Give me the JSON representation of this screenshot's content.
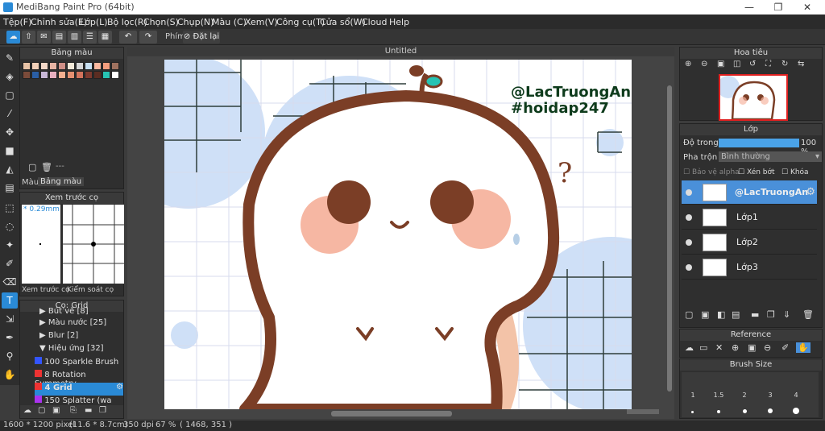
{
  "window": {
    "title": "MediBang Paint Pro (64bit)",
    "min": "—",
    "max": "❐",
    "close": "✕"
  },
  "menu": [
    "Tệp(F)",
    "Chỉnh sửa(E)",
    "Lớp(L)",
    "Bộ lọc(R)",
    "Chọn(S)",
    "Chụp(N)",
    "Màu (C)",
    "Xem(V)",
    "Công cụ(T)",
    "Cửa sổ(W)",
    "Cloud",
    "Help"
  ],
  "toolbar": {
    "phim_label": "Phím",
    "reset_label": "Đặt lại"
  },
  "palette_panel": {
    "title": "Bảng màu",
    "tab_color": "Màu",
    "tab_palette": "Bảng màu",
    "dashes": "---",
    "swatches": [
      "#e8c3a6",
      "#f2d0b8",
      "#f3d7c7",
      "#e7b3a3",
      "#cf8f86",
      "#f2e8d8",
      "#d7d7d7",
      "#c8e0f2",
      "#fcb9a0",
      "#f49d7d",
      "#a0725f",
      "#7b4b3a",
      "#2a5fa6",
      "#c8b7d7",
      "#e8b0c0",
      "#f5b090",
      "#e69071",
      "#d2735c",
      "#7e3a2f",
      "#5b2d22",
      "#27c3b3",
      "#ffffff"
    ]
  },
  "preview_panel": {
    "title": "Xem trước cọ",
    "size": "0.29mm",
    "tab_preview": "Xem trước cọ",
    "tab_control": "Kiểm soát cọ"
  },
  "brush_panel": {
    "title": "Cọ: Grid",
    "groups": [
      {
        "arrow": "▶",
        "label": "Bút vẽ [8]"
      },
      {
        "arrow": "▶",
        "label": "Màu nước [25]"
      },
      {
        "arrow": "▶",
        "label": "Blur [2]"
      },
      {
        "arrow": "▼",
        "label": "Hiệu ứng [32]"
      }
    ],
    "items": [
      {
        "size": "100",
        "name": "Sparkle Brush",
        "color": "#3355ff"
      },
      {
        "size": "8",
        "name": "Rotation Symmetry",
        "color": "#ee3333"
      },
      {
        "size": "4",
        "name": "Grid",
        "color": "#ee3333"
      },
      {
        "size": "150",
        "name": "Splatter (wa",
        "color": "#aa33ee"
      }
    ]
  },
  "canvas": {
    "tab": "Untitled",
    "watermark1": "@LacTruongAn",
    "watermark2": "#hoidap247",
    "question": "?"
  },
  "status": {
    "size": "1600 * 1200 pixel",
    "cm": "(11.6 * 8.7cm)",
    "dpi": "350 dpi",
    "zoom": "67 %",
    "coords": "( 1468, 351 )"
  },
  "navigator": {
    "title": "Hoa tiêu"
  },
  "layers": {
    "title": "Lớp",
    "opacity_label": "Độ trong",
    "opacity_value": "100 %",
    "opacity": 1.0,
    "blend_label": "Pha trộn",
    "blend_value": "Bình thường",
    "protect_alpha": "Bảo vệ alpha",
    "clip": "Xén bớt",
    "lock": "Khóa",
    "rows": [
      {
        "name": "@LacTruongAn",
        "active": true
      },
      {
        "name": "Lớp1",
        "active": false
      },
      {
        "name": "Lớp2",
        "active": false
      },
      {
        "name": "Lớp3",
        "active": false
      }
    ]
  },
  "reference": {
    "title": "Reference"
  },
  "brush_size": {
    "title": "Brush Size",
    "labels": [
      "1",
      "1.5",
      "2",
      "3",
      "4"
    ]
  },
  "colors": {
    "accent": "#2a8ad6",
    "char_brown": "#7b3e26",
    "blush": "#f6b7a3",
    "bg_blue": "#cfe0f7"
  }
}
